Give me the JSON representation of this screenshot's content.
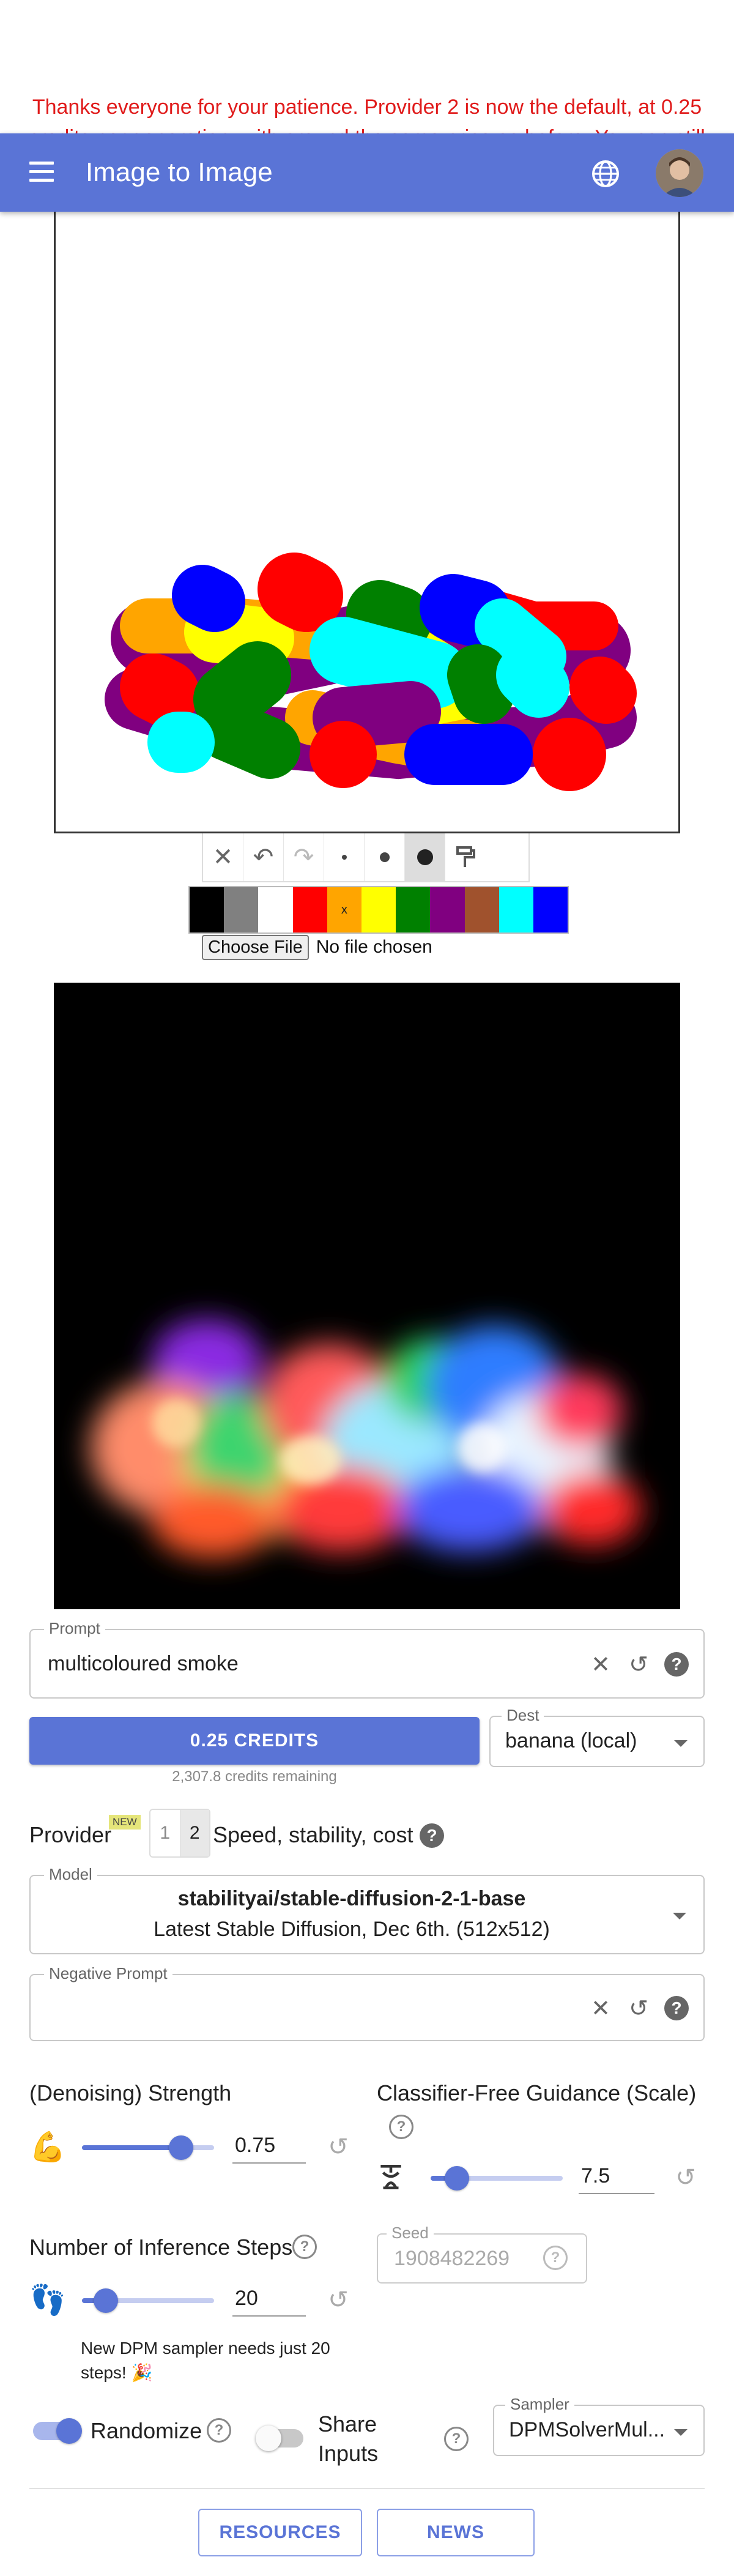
{
  "notice": {
    "text": "Thanks everyone for your patience. Provider 2 is now the default, at 0.25 credits per generation, with around the same price as before. You can still switch"
  },
  "appbar": {
    "title": "Image to Image"
  },
  "drawing": {
    "tools": [
      "clear-icon",
      "undo-icon",
      "redo-icon",
      "brush-small-icon",
      "brush-medium-icon",
      "brush-large-icon",
      "fill-icon"
    ],
    "palette": [
      "#000000",
      "#808080",
      "#ffffff",
      "#ff0000",
      "#ffa500",
      "#ffff00",
      "#008000",
      "#800080",
      "#a0522d",
      "#00ffff",
      "#0000ff"
    ],
    "palette_selected_mark": "x",
    "file_button": "Choose File",
    "file_status": "No file chosen"
  },
  "prompt": {
    "label": "Prompt",
    "value": "multicoloured smoke"
  },
  "credits": {
    "button": "0.25 CREDITS",
    "remaining": "2,307.8 credits remaining"
  },
  "dest": {
    "label": "Dest",
    "value": "banana (local)"
  },
  "provider": {
    "label": "Provider",
    "badge": "NEW",
    "options": [
      "1",
      "2"
    ],
    "selected": "2",
    "desc": "Speed, stability, cost"
  },
  "model": {
    "label": "Model",
    "name": "stabilityai/stable-diffusion-2-1-base",
    "desc": "Latest Stable Diffusion, Dec 6th. (512x512)"
  },
  "negative_prompt": {
    "label": "Negative Prompt",
    "value": ""
  },
  "strength": {
    "label": "(Denoising) Strength",
    "value": "0.75",
    "level": 0.75
  },
  "cfg": {
    "label": "Classifier-Free Guidance (Scale)",
    "value": "7.5",
    "level": 0.2
  },
  "steps": {
    "label": "Number of Inference Steps",
    "value": "20",
    "level": 0.18,
    "note": "New DPM sampler needs just 20 steps! 🎉"
  },
  "seed": {
    "label": "Seed",
    "placeholder": "1908482269"
  },
  "randomize": {
    "label": "Randomize",
    "on": true
  },
  "share": {
    "label": "Share Inputs",
    "on": false
  },
  "sampler": {
    "label": "Sampler",
    "value": "DPMSolverMul..."
  },
  "footer": {
    "resources": "RESOURCES",
    "news": "NEWS"
  },
  "colors": {
    "primary": "#5a74d6",
    "notice": "#e01b1b"
  }
}
